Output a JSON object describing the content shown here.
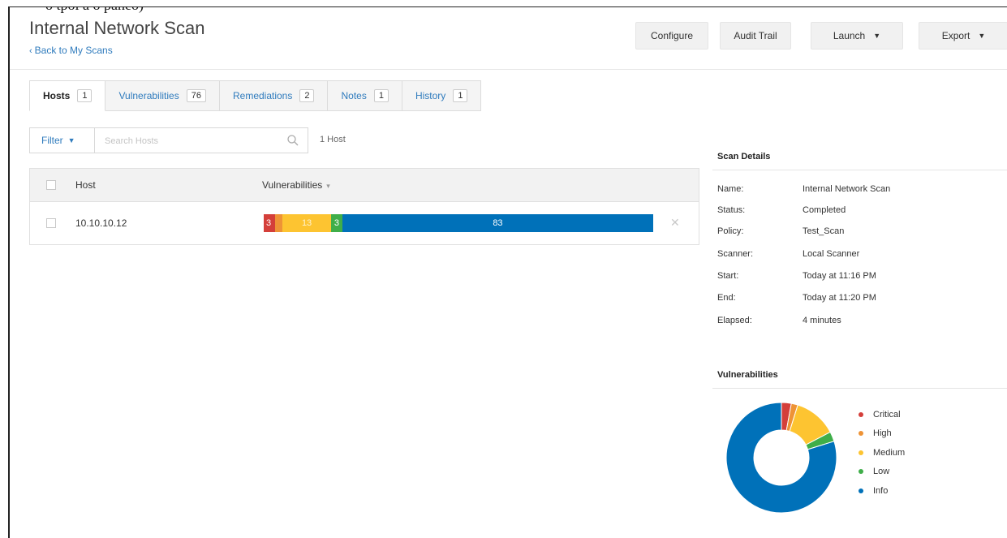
{
  "clipped_top_text": "o tpoi a  o paneo)",
  "header": {
    "title": "Internal Network Scan",
    "back_label": "Back to My Scans",
    "buttons": {
      "configure": "Configure",
      "audit_trail": "Audit Trail",
      "launch": "Launch",
      "export": "Export"
    }
  },
  "tabs": [
    {
      "label": "Hosts",
      "count": "1"
    },
    {
      "label": "Vulnerabilities",
      "count": "76"
    },
    {
      "label": "Remediations",
      "count": "2"
    },
    {
      "label": "Notes",
      "count": "1"
    },
    {
      "label": "History",
      "count": "1"
    }
  ],
  "filter": {
    "label": "Filter",
    "search_placeholder": "Search Hosts",
    "host_count": "1 Host"
  },
  "table": {
    "columns": {
      "host": "Host",
      "vulnerabilities": "Vulnerabilities"
    },
    "rows": [
      {
        "host": "10.10.10.12",
        "segments": [
          {
            "severity": "critical",
            "label": "3",
            "value": 3,
            "color": "#d43f3a"
          },
          {
            "severity": "high",
            "label": "",
            "value": 2,
            "color": "#ee9336"
          },
          {
            "severity": "medium",
            "label": "13",
            "value": 13,
            "color": "#fdc431"
          },
          {
            "severity": "low",
            "label": "3",
            "value": 3,
            "color": "#3fae49"
          },
          {
            "severity": "info",
            "label": "83",
            "value": 83,
            "color": "#0071b9"
          }
        ]
      }
    ]
  },
  "scan_details": {
    "title": "Scan Details",
    "rows": [
      {
        "label": "Name:",
        "value": "Internal Network Scan"
      },
      {
        "label": "Status:",
        "value": "Completed"
      },
      {
        "label": "Policy:",
        "value": "Test_Scan"
      },
      {
        "label": "Scanner:",
        "value": "Local Scanner"
      },
      {
        "label": "Start:",
        "value": "Today at 11:16 PM"
      },
      {
        "label": "End:",
        "value": "Today at 11:20 PM"
      },
      {
        "label": "Elapsed:",
        "value": "4 minutes"
      }
    ]
  },
  "vuln_summary": {
    "title": "Vulnerabilities",
    "legend": [
      {
        "name": "Critical",
        "value": 3,
        "color": "#d43f3a"
      },
      {
        "name": "High",
        "value": 2,
        "color": "#ee9336"
      },
      {
        "name": "Medium",
        "value": 13,
        "color": "#fdc431"
      },
      {
        "name": "Low",
        "value": 3,
        "color": "#3fae49"
      },
      {
        "name": "Info",
        "value": 83,
        "color": "#0071b9"
      }
    ]
  }
}
